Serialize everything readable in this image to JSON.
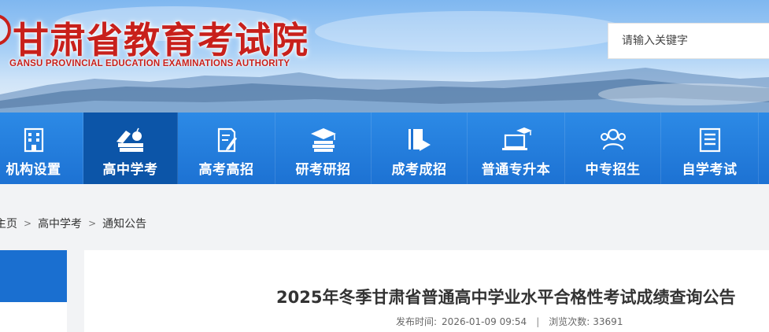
{
  "header": {
    "title": "甘肃省教育考试院",
    "subtitle": "GANSU PROVINCIAL EDUCATION EXAMINATIONS AUTHORITY",
    "brand_color": "#c8201b"
  },
  "search": {
    "placeholder": "请输入关键字",
    "value": ""
  },
  "nav": {
    "items": [
      {
        "label": "机构设置",
        "icon": "building-icon",
        "active": false
      },
      {
        "label": "高中学考",
        "icon": "books-apple-icon",
        "active": true
      },
      {
        "label": "高考高招",
        "icon": "document-pen-icon",
        "active": false
      },
      {
        "label": "研考研招",
        "icon": "graduation-books-icon",
        "active": false
      },
      {
        "label": "成考成招",
        "icon": "book-arrow-icon",
        "active": false
      },
      {
        "label": "普通专升本",
        "icon": "laptop-graduation-icon",
        "active": false
      },
      {
        "label": "中专招生",
        "icon": "people-icon",
        "active": false
      },
      {
        "label": "自学考试",
        "icon": "list-document-icon",
        "active": false
      }
    ],
    "bg_color": "#1d72d3",
    "active_color": "#0c55a8"
  },
  "breadcrumb": {
    "items": [
      "主页",
      "高中学考",
      "通知公告"
    ],
    "separator": ">"
  },
  "article": {
    "title": "2025年冬季甘肃省普通高中学业水平合格性考试成绩查询公告",
    "publish_label": "发布时间:",
    "publish_time": "2026-01-09 09:54",
    "divider": "|",
    "views_label": "浏览次数:",
    "views": "33691"
  }
}
